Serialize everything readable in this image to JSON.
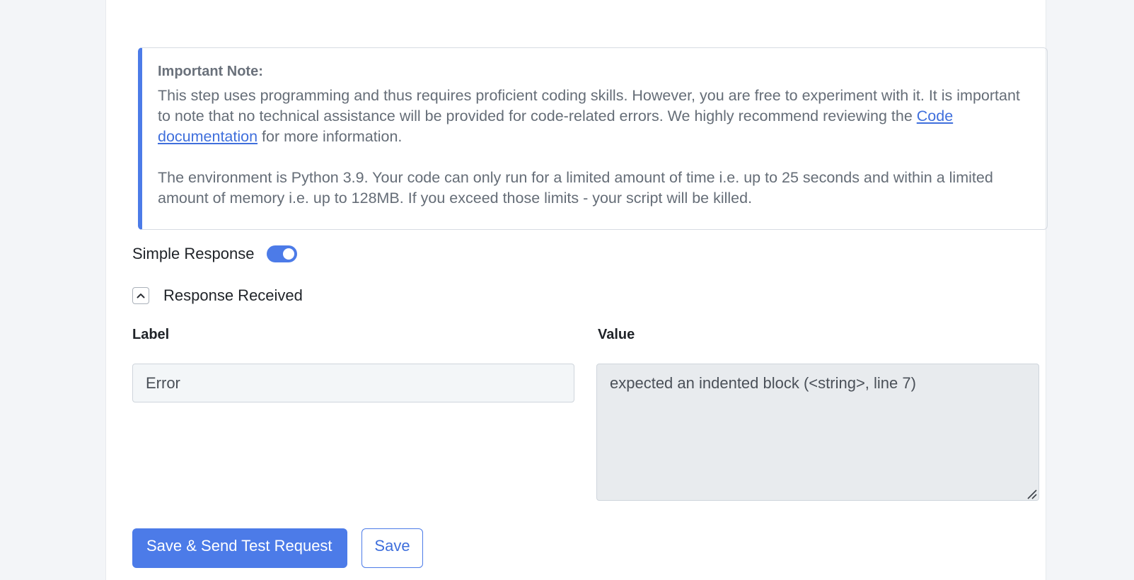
{
  "note": {
    "title": "Important Note:",
    "para1_before_link": "This step uses programming and thus requires proficient coding skills. However, you are free to experiment with it. It is important to note that no technical assistance will be provided for code-related errors. We highly recommend reviewing the ",
    "link_text": "Code documentation",
    "para1_after_link": " for more information.",
    "para2": "The environment is Python 3.9. Your code can only run for a limited amount of time i.e. up to 25 seconds and within a limited amount of memory i.e. up to 128MB. If you exceed those limits - your script will be killed."
  },
  "simple_response": {
    "label": "Simple Response",
    "enabled": true
  },
  "response_received": {
    "label": "Response Received",
    "expanded": true
  },
  "fields": {
    "label_header": "Label",
    "value_header": "Value",
    "label_value": "Error",
    "value_value": "expected an indented block (<string>, line 7)"
  },
  "actions": {
    "save_send_label": "Save & Send Test Request",
    "save_label": "Save"
  },
  "colors": {
    "accent": "#4c7be8",
    "link": "#3f6fdc",
    "page_bg": "#f3f5f8"
  },
  "icons": {
    "toggle": "toggle-switch-icon",
    "collapse": "chevron-up-icon",
    "resize": "resize-grip-icon"
  }
}
